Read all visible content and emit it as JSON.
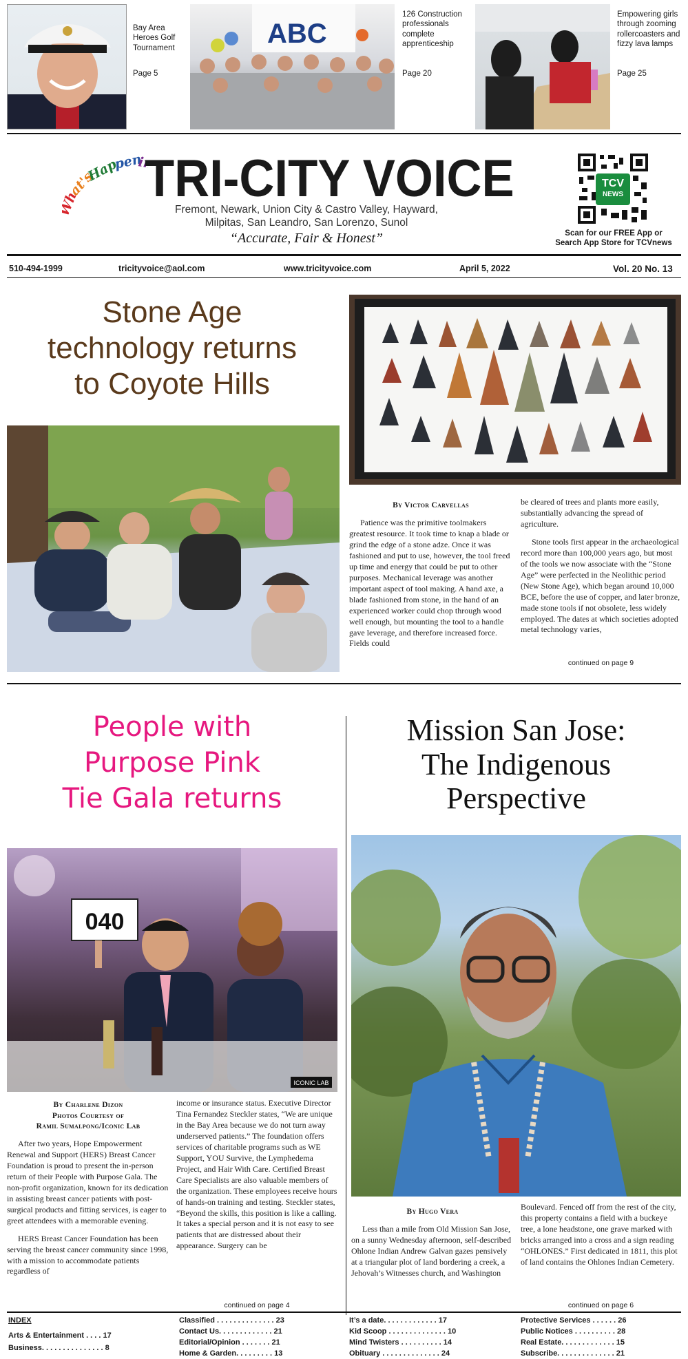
{
  "teasers": [
    {
      "text": "Bay Area Heroes Golf Tournament",
      "page": "Page 5"
    },
    {
      "text": "126 Construction professionals complete apprenticeship",
      "page": "Page 20"
    },
    {
      "text": "Empowering girls through zooming rollercoasters and fizzy lava lamps",
      "page": "Page 25"
    }
  ],
  "masthead": {
    "tagline_art": "What's Happening",
    "title": "TRI-CITY VOICE",
    "cities_line1": "Fremont, Newark, Union City & Castro Valley, Hayward,",
    "cities_line2": "Milpitas, San Leandro, San Lorenzo, Sunol",
    "motto": "“Accurate, Fair & Honest”",
    "qr_badge_line1": "TCV",
    "qr_badge_line2": "NEWS",
    "app_line1": "Scan for our FREE App or",
    "app_line2": "Search App Store for TCVnews"
  },
  "info_bar": {
    "phone": "510-494-1999",
    "email": "tricityvoice@aol.com",
    "website": "www.tricityvoice.com",
    "date": "April 5, 2022",
    "volume": "Vol. 20  No. 13"
  },
  "story1": {
    "headline": [
      "Stone Age",
      "technology returns",
      "to Coyote Hills"
    ],
    "byline": "By Victor Carvellas",
    "col1": "Patience was the primitive toolmakers greatest resource. It took time to knap a blade or grind the edge of a stone adze. Once it was fashioned and put to use, however, the tool freed up time and energy that could be put to other purposes. Mechanical leverage was another important aspect of tool making. A hand axe, a blade fashioned from stone, in the hand of an experienced worker could chop through wood well enough, but mounting the tool to a handle gave leverage, and therefore increased force. Fields could",
    "col2a": "be cleared of trees and plants more easily, substantially advancing the spread of agriculture.",
    "col2b": "Stone tools first appear in the archaeological record more than 100,000 years ago, but most of the tools we now associate with the “Stone Age” were perfected in the Neolithic period (New Stone Age), which began around 10,000 BCE, before the use of copper, and later bronze, made stone tools if not obsolete, less widely employed. The dates at which societies adopted metal technology varies,",
    "continued": "continued on page 9"
  },
  "story2": {
    "headline": [
      "People with",
      "Purpose Pink",
      "Tie Gala returns"
    ],
    "byline_line1": "By Charlene Dizon",
    "byline_line2": "Photos Courtesy of",
    "byline_line3": "Ramil Sumalpong/Iconic Lab",
    "paddle_number": "040",
    "photo_credit": "ICONIC LAB",
    "col1a": "After two years, Hope Empowerment Renewal and Support (HERS) Breast Cancer Foundation is proud to present the in-person return of their People with Purpose Gala. The non-profit organization, known for its dedication in assisting breast cancer patients with post-surgical products and fitting services, is eager to greet attendees with a memorable evening.",
    "col1b": "HERS Breast Cancer Foundation has been serving the breast cancer community since 1998, with a mission to accommodate patients regardless of",
    "col2": "income or insurance status. Executive Director Tina Fernandez Steckler states, “We are unique in the Bay Area because we do not turn away underserved patients.” The foundation offers services of charitable programs such as WE Support, YOU Survive, the Lymphedema Project, and Hair With Care. Certified Breast Care Specialists are also valuable members of the organization. These employees receive hours of hands-on training and testing. Steckler states, “Beyond the skills, this position is like a calling. It takes a special person and it is not easy to see patients that are distressed about their appearance. Surgery can be",
    "continued": "continued on page 4"
  },
  "story3": {
    "headline": [
      "Mission San Jose:",
      "The Indigenous",
      "Perspective"
    ],
    "byline": "By Hugo Vera",
    "col1": "Less than a mile from Old Mission San Jose, on  a sunny Wednesday afternoon, self-described Ohlone Indian Andrew Galvan gazes pensively at a triangular plot of land bordering a creek, a Jehovah’s Witnesses church, and Washington",
    "col2": "Boulevard. Fenced off from the rest of the city, this property contains a field with a buckeye tree, a lone headstone, one grave marked with bricks arranged into a cross and a sign reading “OHLONES.” First dedicated in 1811, this plot of land contains the Ohlones Indian Cemetery.",
    "continued": "continued on page 6"
  },
  "index": {
    "title": "INDEX",
    "col1": [
      "Arts & Entertainment . . . . 17",
      "Business. . . . . . . . . . . . . . . 8"
    ],
    "col2": [
      "Classified . . . . . . . . . . . . . . 23",
      "Contact Us. . . . . . . . . . . . . 21",
      "Editorial/Opinion . . . . . . . 21",
      "Home & Garden. . . . . . . . . 13"
    ],
    "col3": [
      "It’s a date. . . . . . . . . . . . . 17",
      "Kid Scoop . . . . . . . . . . . . . . 10",
      "Mind Twisters . . . . . . . . . . 14",
      "Obituary . . . . . . . . . . . . . . 24"
    ],
    "col4": [
      "Protective Services . . . . . . 26",
      "Public Notices . . . . . . . . . . 28",
      "Real Estate. . . . . . . . . . . . . 15",
      "Subscribe. . . . . . . . . . . . . . 21"
    ]
  }
}
